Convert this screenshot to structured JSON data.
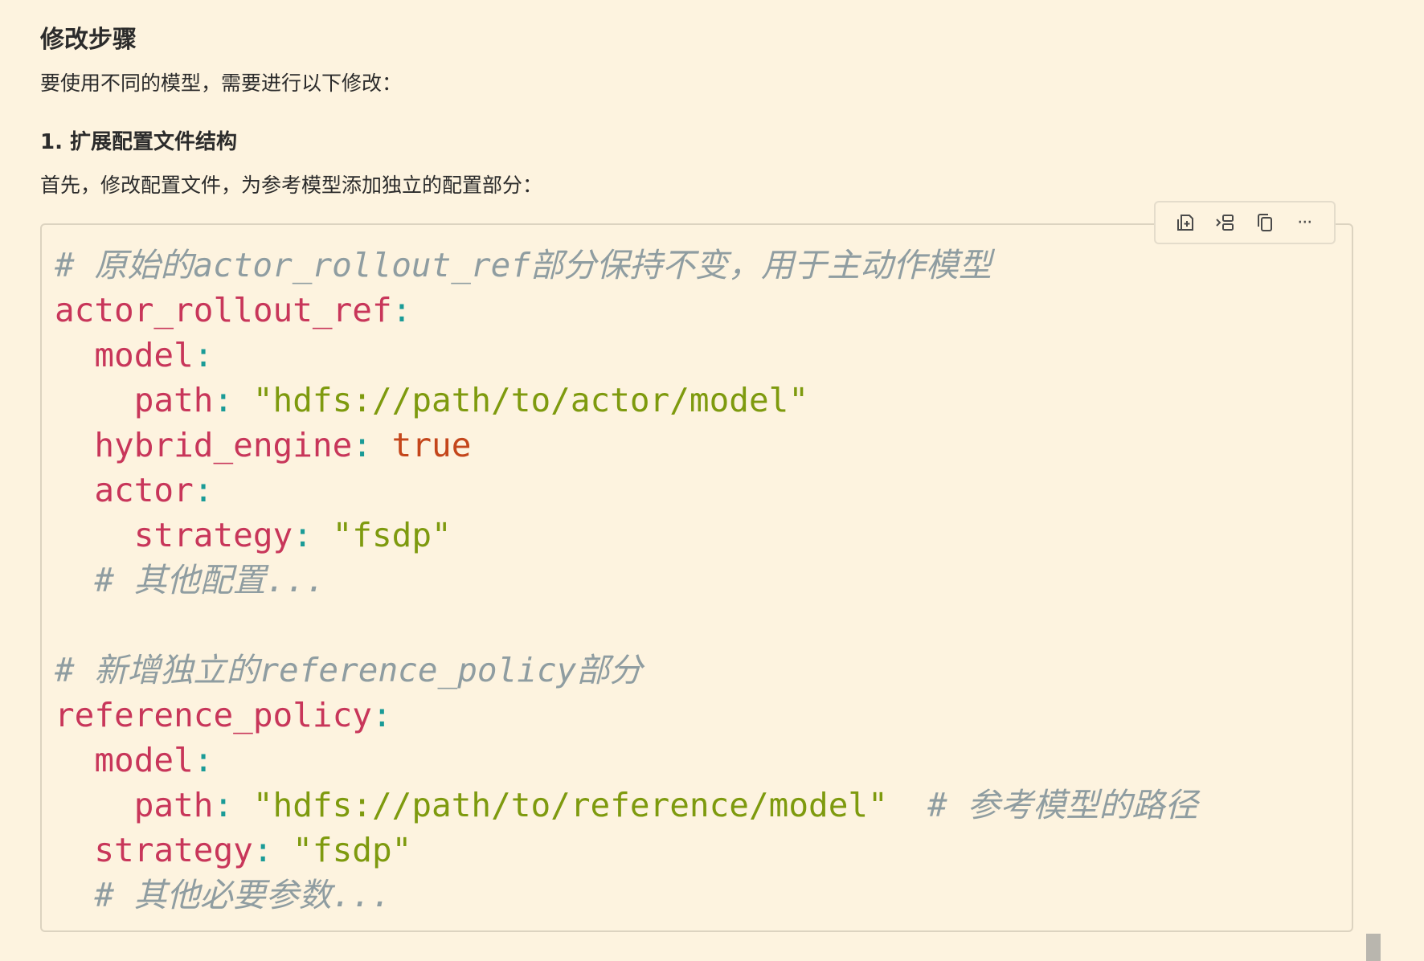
{
  "section_title": "修改步骤",
  "intro_text": "要使用不同的模型，需要进行以下修改：",
  "step_title": "1. 扩展配置文件结构",
  "step_text": "首先，修改配置文件，为参考模型添加独立的配置部分：",
  "toolbar": {
    "icons": [
      "insert-icon",
      "split-icon",
      "copy-icon",
      "more-icon"
    ],
    "more_label": "···"
  },
  "code_lines": [
    [
      {
        "t": "comment",
        "v": "# 原始的actor_rollout_ref部分保持不变，用于主动作模型"
      }
    ],
    [
      {
        "t": "key",
        "v": "actor_rollout_ref"
      },
      {
        "t": "punct",
        "v": ":"
      }
    ],
    [
      {
        "t": "plain",
        "v": "  "
      },
      {
        "t": "key",
        "v": "model"
      },
      {
        "t": "punct",
        "v": ":"
      }
    ],
    [
      {
        "t": "plain",
        "v": "    "
      },
      {
        "t": "key",
        "v": "path"
      },
      {
        "t": "punct",
        "v": ": "
      },
      {
        "t": "str",
        "v": "\"hdfs://path/to/actor/model\""
      }
    ],
    [
      {
        "t": "plain",
        "v": "  "
      },
      {
        "t": "key",
        "v": "hybrid_engine"
      },
      {
        "t": "punct",
        "v": ": "
      },
      {
        "t": "bool",
        "v": "true"
      }
    ],
    [
      {
        "t": "plain",
        "v": "  "
      },
      {
        "t": "key",
        "v": "actor"
      },
      {
        "t": "punct",
        "v": ":"
      }
    ],
    [
      {
        "t": "plain",
        "v": "    "
      },
      {
        "t": "key",
        "v": "strategy"
      },
      {
        "t": "punct",
        "v": ": "
      },
      {
        "t": "str",
        "v": "\"fsdp\""
      }
    ],
    [
      {
        "t": "plain",
        "v": "  "
      },
      {
        "t": "comment",
        "v": "# 其他配置..."
      }
    ],
    [],
    [
      {
        "t": "comment",
        "v": "# 新增独立的reference_policy部分"
      }
    ],
    [
      {
        "t": "key",
        "v": "reference_policy"
      },
      {
        "t": "punct",
        "v": ":"
      }
    ],
    [
      {
        "t": "plain",
        "v": "  "
      },
      {
        "t": "key",
        "v": "model"
      },
      {
        "t": "punct",
        "v": ":"
      }
    ],
    [
      {
        "t": "plain",
        "v": "    "
      },
      {
        "t": "key",
        "v": "path"
      },
      {
        "t": "punct",
        "v": ": "
      },
      {
        "t": "str",
        "v": "\"hdfs://path/to/reference/model\""
      },
      {
        "t": "plain",
        "v": "  "
      },
      {
        "t": "comment",
        "v": "# 参考模型的路径"
      }
    ],
    [
      {
        "t": "plain",
        "v": "  "
      },
      {
        "t": "key",
        "v": "strategy"
      },
      {
        "t": "punct",
        "v": ": "
      },
      {
        "t": "str",
        "v": "\"fsdp\""
      }
    ],
    [
      {
        "t": "plain",
        "v": "  "
      },
      {
        "t": "comment",
        "v": "# 其他必要参数..."
      }
    ]
  ]
}
